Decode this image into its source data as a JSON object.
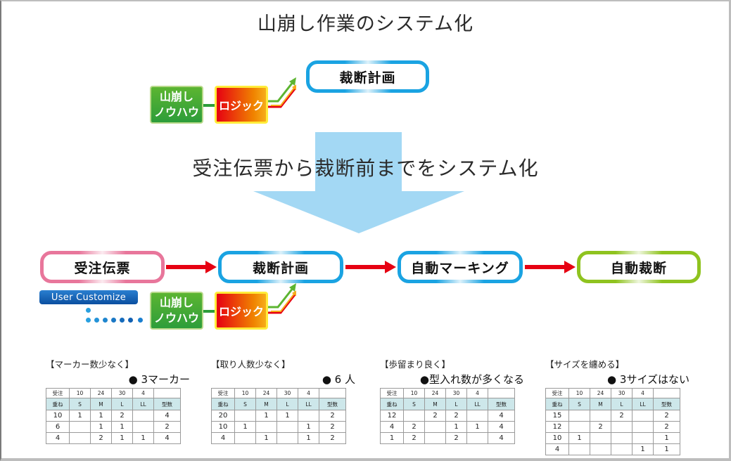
{
  "title": "山崩し作業のシステム化",
  "subtitle": "受注伝票から裁断前までをシステム化",
  "top_group": {
    "knowhow_label_line1": "山崩し",
    "knowhow_label_line2": "ノウハウ",
    "logic_label": "ロジック",
    "target_label": "裁断計画"
  },
  "flow": {
    "steps": [
      {
        "label": "受注伝票",
        "color": "#e8769b"
      },
      {
        "label": "裁断計画",
        "color": "#1aa3e2"
      },
      {
        "label": "自動マーキング",
        "color": "#1aa3e2"
      },
      {
        "label": "自動裁断",
        "color": "#8fc31f"
      }
    ],
    "arrow_color": "#e60012"
  },
  "bottom_group": {
    "user_customize_label": "User Customize",
    "knowhow_label_line1": "山崩し",
    "knowhow_label_line2": "ノウハウ",
    "logic_label": "ロジック"
  },
  "colors": {
    "big_arrow": "#a3d8f4",
    "knowhow_green": "#2d9d3a",
    "logic_red": "#e60012",
    "logic_orange": "#f08300",
    "size_row_bg": "#cde7ea"
  },
  "tables": [
    {
      "heading": "【マーカー数少なく】",
      "note": "● 3マーカー",
      "order_row": [
        "受注",
        "10",
        "24",
        "30",
        "4",
        ""
      ],
      "size_row": [
        "重ね",
        "S",
        "M",
        "L",
        "LL",
        "型数"
      ],
      "rows": [
        [
          "10",
          "1",
          "1",
          "2",
          "",
          "4"
        ],
        [
          "6",
          "",
          "1",
          "1",
          "",
          "2"
        ],
        [
          "4",
          "",
          "2",
          "1",
          "1",
          "4"
        ]
      ]
    },
    {
      "heading": "【取り人数少なく】",
      "note": "● 6 人",
      "order_row": [
        "受注",
        "10",
        "24",
        "30",
        "4",
        ""
      ],
      "size_row": [
        "重ね",
        "S",
        "M",
        "L",
        "LL",
        "型数"
      ],
      "rows": [
        [
          "20",
          "",
          "1",
          "1",
          "",
          "2"
        ],
        [
          "10",
          "1",
          "",
          "",
          "1",
          "2"
        ],
        [
          "4",
          "",
          "1",
          "",
          "1",
          "2"
        ]
      ]
    },
    {
      "heading": "【歩留まり良く】",
      "note": "●型入れ数が多くなる",
      "order_row": [
        "受注",
        "10",
        "24",
        "30",
        "4",
        ""
      ],
      "size_row": [
        "重ね",
        "S",
        "M",
        "L",
        "LL",
        "型数"
      ],
      "rows": [
        [
          "12",
          "",
          "2",
          "2",
          "",
          "4"
        ],
        [
          "4",
          "2",
          "",
          "1",
          "1",
          "4"
        ],
        [
          "1",
          "2",
          "",
          "2",
          "",
          "4"
        ]
      ]
    },
    {
      "heading": "【サイズを纏める】",
      "note": "● 3サイズはない",
      "order_row": [
        "受注",
        "10",
        "24",
        "30",
        "4",
        ""
      ],
      "size_row": [
        "重ね",
        "S",
        "M",
        "L",
        "LL",
        "型数"
      ],
      "rows": [
        [
          "15",
          "",
          "",
          "2",
          "",
          "2"
        ],
        [
          "12",
          "",
          "2",
          "",
          "",
          "2"
        ],
        [
          "10",
          "1",
          "",
          "",
          "",
          "1"
        ],
        [
          "4",
          "",
          "",
          "",
          "1",
          "1"
        ]
      ]
    }
  ]
}
